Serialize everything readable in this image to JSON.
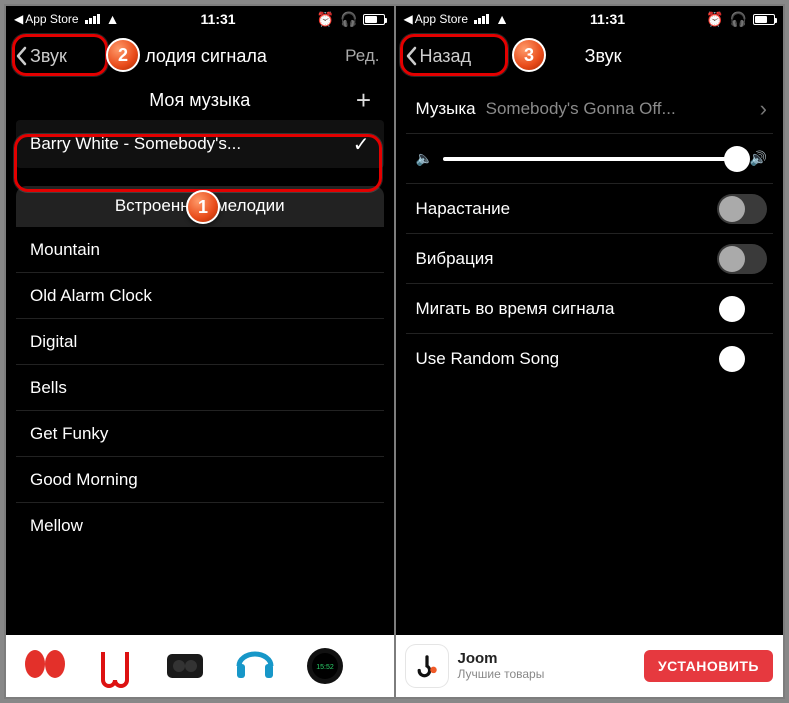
{
  "status": {
    "breadcrumb": "App Store",
    "time": "11:31"
  },
  "left": {
    "nav_back": "Звук",
    "nav_title": "лодия сигнала",
    "nav_edit": "Ред.",
    "my_music_header": "Моя музыка",
    "selected_track": "Barry White -  Somebody's...",
    "builtin_header": "Встроенные мелодии",
    "melodies": [
      "Mountain",
      "Old Alarm Clock",
      "Digital",
      "Bells",
      "Get Funky",
      "Good Morning",
      "Mellow"
    ]
  },
  "right": {
    "nav_back": "Назад",
    "nav_title": "Звук",
    "music_label": "Музыка",
    "music_value": "Somebody's Gonna Off...",
    "rows": {
      "fade_in": "Нарастание",
      "vibration": "Вибрация",
      "flash": "Мигать во время сигнала",
      "random": "Use Random Song"
    }
  },
  "ad": {
    "joom_title": "Joom",
    "joom_sub": "Лучшие товары",
    "install": "УСТАНОВИТЬ"
  },
  "markers": {
    "m1": "1",
    "m2": "2",
    "m3": "3"
  }
}
